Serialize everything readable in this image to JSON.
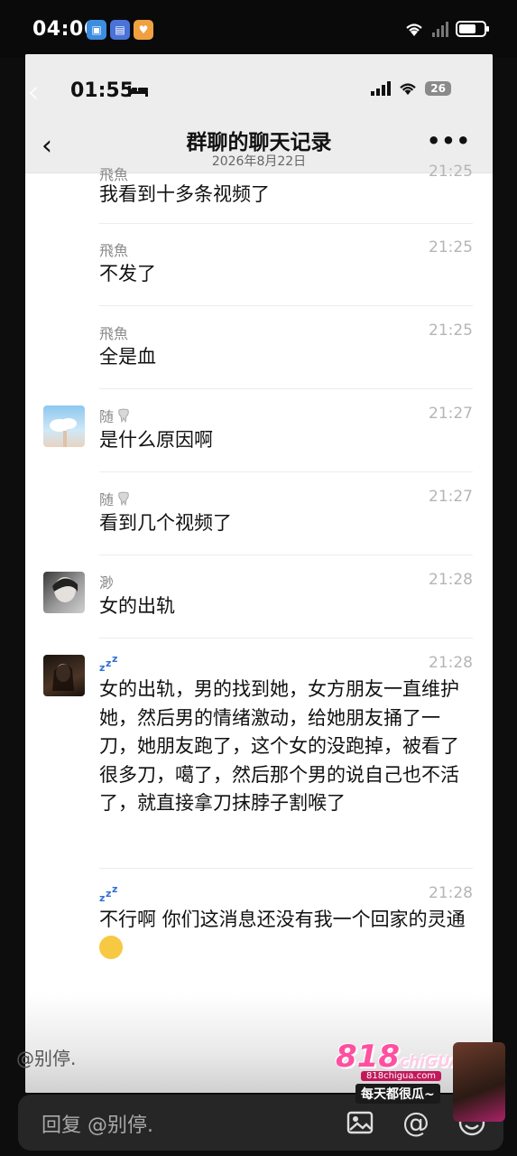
{
  "outer_status": {
    "time": "04:06"
  },
  "inner_status": {
    "time": "01:55",
    "battery": "26"
  },
  "header": {
    "title": "群聊的聊天记录",
    "date": "2026年8月22日"
  },
  "messages": [
    {
      "sender": "飛魚",
      "time": "21:25",
      "text": "我看到十多条视频了",
      "avatar": ""
    },
    {
      "sender": "飛魚",
      "time": "21:25",
      "text": "不发了",
      "avatar": ""
    },
    {
      "sender": "飛魚",
      "time": "21:25",
      "text": "全是血",
      "avatar": ""
    },
    {
      "sender": "随",
      "time": "21:27",
      "text": "是什么原因啊",
      "avatar": "sky-avatar"
    },
    {
      "sender": "随",
      "time": "21:27",
      "text": "看到几个视频了",
      "avatar": ""
    },
    {
      "sender": "渺",
      "time": "21:28",
      "text": "女的出轨",
      "avatar": "portrait-avatar"
    },
    {
      "sender": "",
      "time": "21:28",
      "text": "女的出轨，男的找到她，女方朋友一直维护她，然后男的情绪激动，给她朋友捅了一刀，她朋友跑了，这个女的没跑掉，被看了很多刀，噶了，然后那个男的说自己也不活了，就直接拿刀抹脖子割喉了",
      "avatar": "dark-avatar"
    },
    {
      "sender": "",
      "time": "21:28",
      "text": "不行啊 你们这消息还没有我一个回家的灵通",
      "avatar": ""
    }
  ],
  "mention_hint": "@别停.",
  "reply": {
    "placeholder": "回复 @别停."
  },
  "watermark": {
    "logo": "818",
    "logo_sub": "chiGUA",
    "site": "818chigua.com",
    "slogan": "每天都很瓜~"
  },
  "colors": {
    "header_bg": "#ededed",
    "chat_bg": "#ffffff",
    "reply_bar": "#262626",
    "brand_pink": "#ff4fa0"
  }
}
